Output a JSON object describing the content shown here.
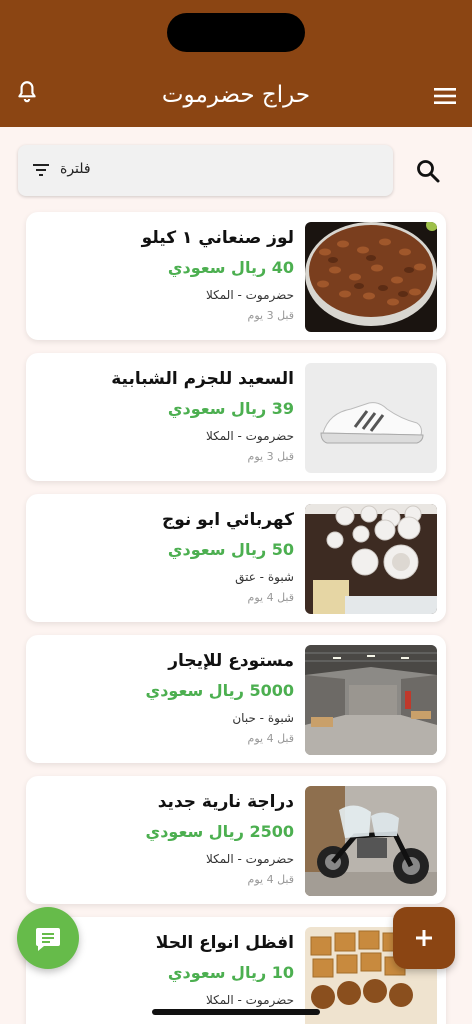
{
  "header": {
    "title": "حراج حضرموت",
    "bell_icon": "bell-outline-icon",
    "menu_icon": "hamburger-menu-icon",
    "background": "#8b4513"
  },
  "filter": {
    "label": "فلترة",
    "icon": "filter-list-icon"
  },
  "search_icon": "search-icon",
  "listings": [
    {
      "title": "لوز صنعاني ١ كيلو",
      "price": "40 ريال سعودي",
      "location": "حضرموت - المكلا",
      "time": "قبل 3 يوم",
      "image": "almonds-photo"
    },
    {
      "title": "السعيد للجزم  الشبابية",
      "price": "39 ريال سعودي",
      "location": "حضرموت - المكلا",
      "time": "قبل 3 يوم",
      "image": "white-sneaker-photo"
    },
    {
      "title": "كهربائي ابو نوج",
      "price": "50 ريال سعودي",
      "location": "شبوة - عتق",
      "time": "قبل 4 يوم",
      "image": "light-fixtures-photo"
    },
    {
      "title": "مستودع للإيجار",
      "price": "5000 ريال سعودي",
      "location": "شبوة - حبان",
      "time": "قبل 4 يوم",
      "image": "warehouse-photo"
    },
    {
      "title": "دراجة نارية جديد",
      "price": "2500 ريال سعودي",
      "location": "حضرموت - المكلا",
      "time": "قبل 4 يوم",
      "image": "motorcycle-photo"
    },
    {
      "title": "افظل انواع الحلا",
      "price": "10 ريال سعودي",
      "location": "حضرموت - المكلا",
      "time": "",
      "image": "sweets-photo"
    }
  ],
  "fab_chat_icon": "chat-icon",
  "fab_add_icon": "plus-icon",
  "colors": {
    "price": "#4caf50",
    "accent": "#8b4513",
    "chat_fab": "#66bb4a"
  }
}
